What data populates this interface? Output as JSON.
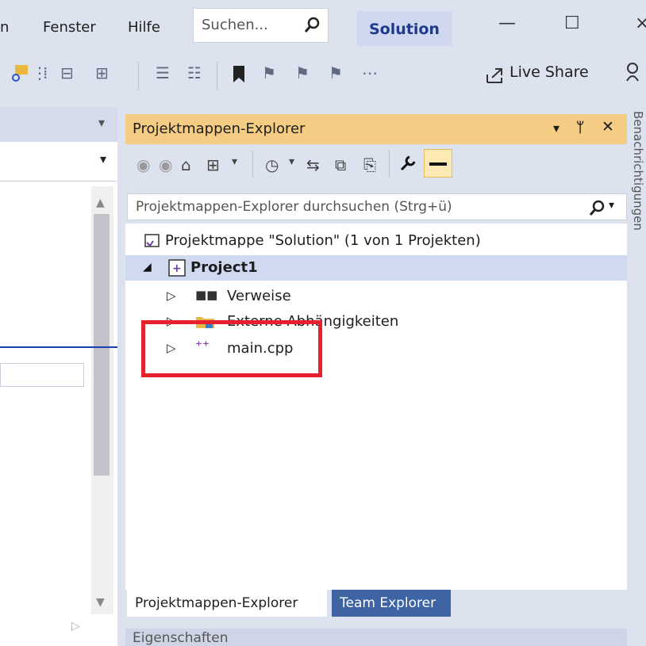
{
  "menu": {
    "partial": "n",
    "window": "Fenster",
    "help": "Hilfe"
  },
  "search": {
    "placeholder": "Suchen...",
    "icon": "search-icon"
  },
  "solution_badge": "Solution",
  "window_controls": {
    "minimize": "—",
    "maximize": "☐",
    "close": "×"
  },
  "toolbar": {
    "live_share": "Live Share",
    "live_share_icon": "share-icon"
  },
  "solution_explorer": {
    "title": "Projektmappen-Explorer",
    "title_controls": {
      "dropdown": "▾",
      "pin": "ᛘ",
      "close": "✕"
    },
    "search_placeholder": "Projektmappen-Explorer durchsuchen (Strg+ü)",
    "tree": {
      "solution": "Projektmappe \"Solution\" (1 von 1 Projekten)",
      "project": "Project1",
      "items": [
        "Verweise",
        "Externe Abhängigkeiten",
        "main.cpp"
      ]
    },
    "tabs": [
      "Projektmappen-Explorer",
      "Team Explorer"
    ]
  },
  "properties_title": "Eigenschaften",
  "right_strip_label": "Benachrichtigungen",
  "colors": {
    "accent": "#f5cc84",
    "selected": "#cfdaf1",
    "highlight_box": "#e6202d",
    "tab_inactive": "#3e64a3"
  }
}
